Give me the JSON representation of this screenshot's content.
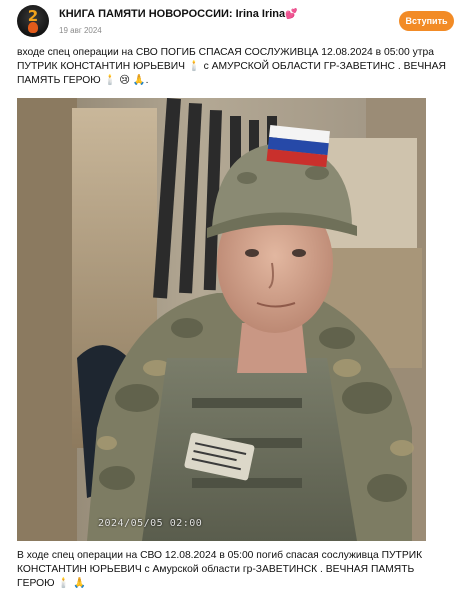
{
  "post": {
    "channel_title": "КНИГА ПАМЯТИ НОВОРОССИИ: Irina Irina",
    "heart_emoji": "💕",
    "date": "19 авг 2024",
    "join_label": "Вступить",
    "avatar_number": "2",
    "caption_top": "входе спец операции на СВО ПОГИБ СПАСАЯ СОСЛУЖИВЦА 12.08.2024 в 05:00 утра ПУТРИК КОНСТАНТИН ЮРЬЕВИЧ 🕯️ с АМУРСКОЙ ОБЛАСТИ ГР-ЗАВЕТИНС . ВЕЧНАЯ ПАМЯТЬ ГЕРОЮ 🕯️ 😢 🙏.",
    "photo_timestamp": "2024/05/05 02:00",
    "caption_bottom": "В ходе спец операции на СВО 12.08.2024 в 05:00 погиб спасая сослуживца ПУТРИК КОНСТАНТИН ЮРЬЕВИЧ с Амурской области гр-ЗАВЕТИНСК . ВЕЧНАЯ ПАМЯТЬ ГЕРОЮ 🕯️ 🙏",
    "vest_patch": "ПОЗЫВНОЙ ... ГРУППА КРОВИ"
  },
  "colors": {
    "accent": "#f28b26",
    "date_gray": "#8b8b8b"
  }
}
